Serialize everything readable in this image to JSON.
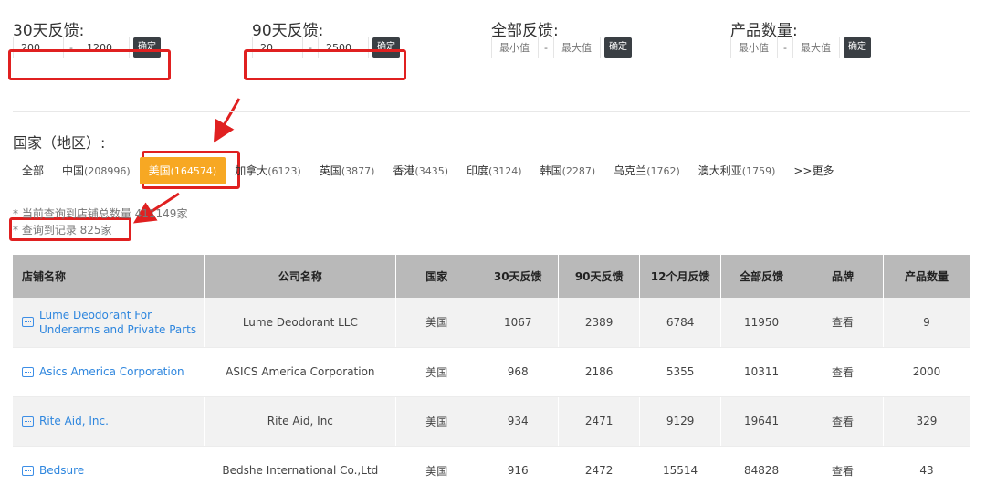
{
  "filters": [
    {
      "label": "30天反馈:",
      "min": "200",
      "max": "1200",
      "min_ph": "最小值",
      "max_ph": "最大值",
      "button": "确定"
    },
    {
      "label": "90天反馈:",
      "min": "20",
      "max": "2500",
      "min_ph": "最小值",
      "max_ph": "最大值",
      "button": "确定"
    },
    {
      "label": "全部反馈:",
      "min": "",
      "max": "",
      "min_ph": "最小值",
      "max_ph": "最大值",
      "button": "确定"
    },
    {
      "label": "产品数量:",
      "min": "",
      "max": "",
      "min_ph": "最小值",
      "max_ph": "最大值",
      "button": "确定"
    }
  ],
  "country": {
    "title": "国家（地区）:",
    "tabs": [
      {
        "name": "全部",
        "count": ""
      },
      {
        "name": "中国",
        "count": "(208996)"
      },
      {
        "name": "美国",
        "count": "(164574)"
      },
      {
        "name": "加拿大",
        "count": "(6123)"
      },
      {
        "name": "英国",
        "count": "(3877)"
      },
      {
        "name": "香港",
        "count": "(3435)"
      },
      {
        "name": "印度",
        "count": "(3124)"
      },
      {
        "name": "韩国",
        "count": "(2287)"
      },
      {
        "name": "乌克兰",
        "count": "(1762)"
      },
      {
        "name": "澳大利亚",
        "count": "(1759)"
      },
      {
        "name": ">>更多",
        "count": ""
      }
    ],
    "active_index": 2
  },
  "info": {
    "total_stores": "* 当前查询到店铺总数量 411149家",
    "records": "* 查询到记录 825家"
  },
  "table": {
    "headers": [
      "店铺名称",
      "公司名称",
      "国家",
      "30天反馈",
      "90天反馈",
      "12个月反馈",
      "全部反馈",
      "品牌",
      "产品数量"
    ],
    "rows": [
      [
        "Lume Deodorant For Underarms and Private Parts",
        "Lume Deodorant LLC",
        "美国",
        "1067",
        "2389",
        "6784",
        "11950",
        "查看",
        "9"
      ],
      [
        "Asics America Corporation",
        "ASICS America Corporation",
        "美国",
        "968",
        "2186",
        "5355",
        "10311",
        "查看",
        "2000"
      ],
      [
        "Rite Aid, Inc.",
        "Rite Aid, Inc",
        "美国",
        "934",
        "2471",
        "9129",
        "19641",
        "查看",
        "329"
      ],
      [
        "Bedsure",
        "Bedshe International Co.,Ltd",
        "美国",
        "916",
        "2472",
        "15514",
        "84828",
        "查看",
        "43"
      ]
    ]
  },
  "colors": {
    "active_tab": "#f7a823",
    "highlight": "#e02020",
    "link": "#2e86de"
  }
}
